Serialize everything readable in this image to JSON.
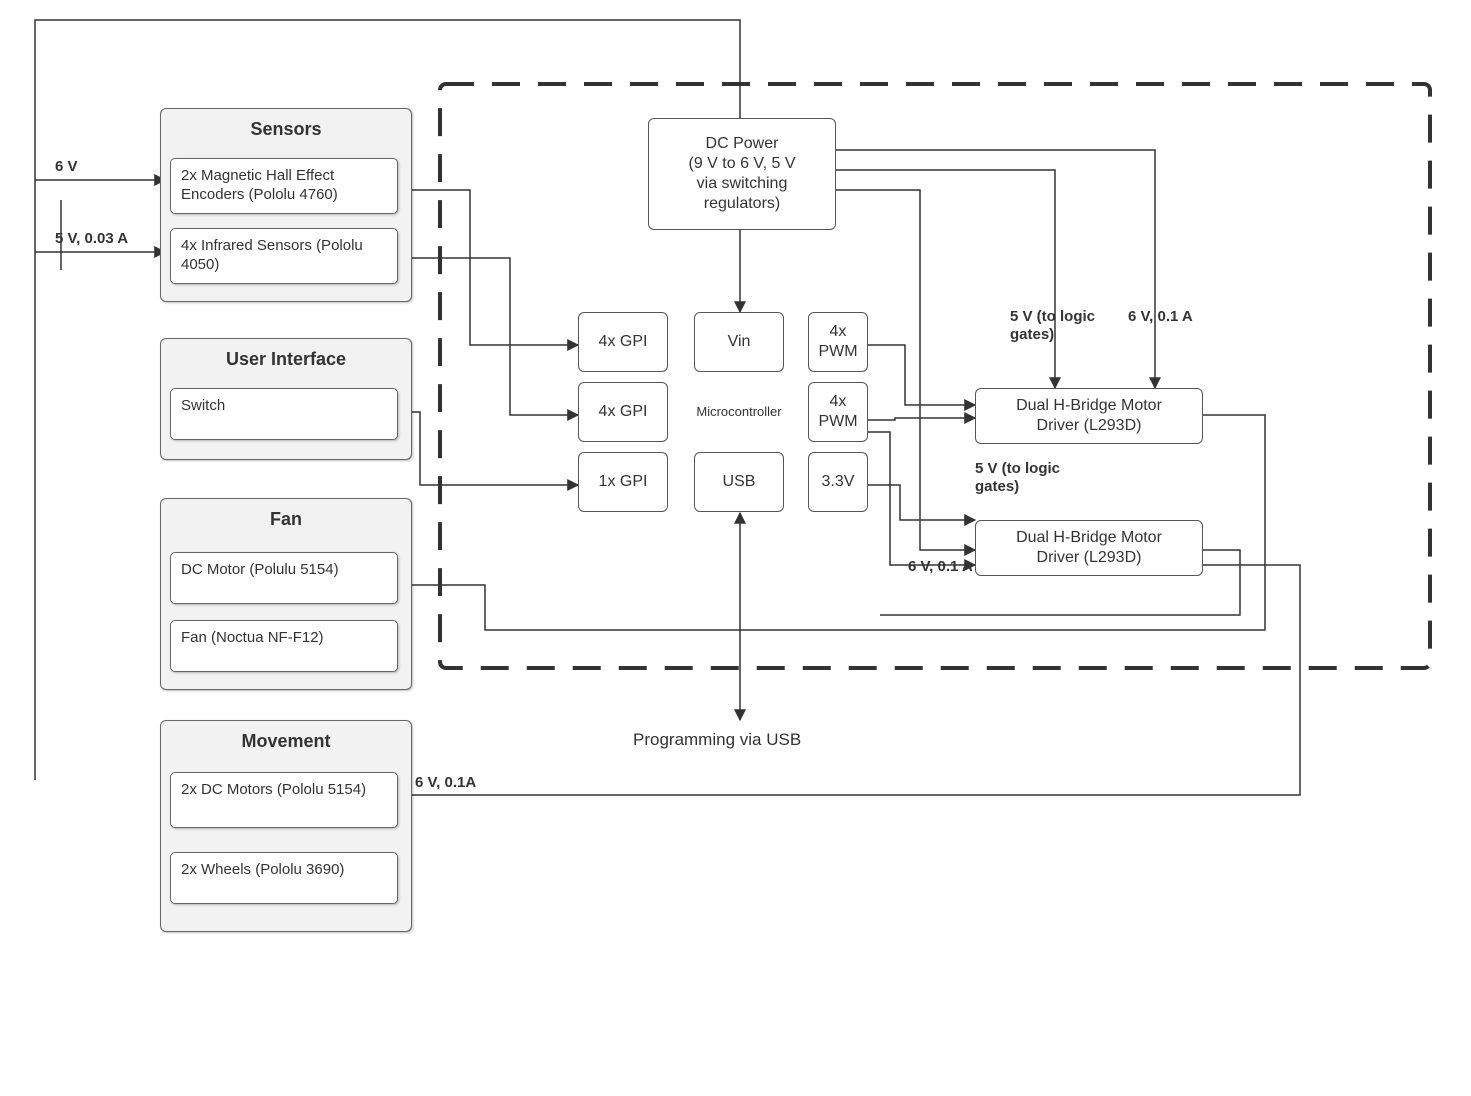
{
  "groups": {
    "sensors": {
      "title": "Sensors",
      "item1": "2x Magnetic Hall Effect Encoders (Pololu 4760)",
      "item2": "4x Infrared Sensors (Pololu 4050)"
    },
    "ui": {
      "title": "User Interface",
      "item1": "Switch"
    },
    "fan": {
      "title": "Fan",
      "item1": "DC Motor (Polulu 5154)",
      "item2": "Fan (Noctua NF-F12)"
    },
    "movement": {
      "title": "Movement",
      "item1": "2x DC Motors (Pololu 5154)",
      "item2": "2x Wheels (Pololu 3690)"
    }
  },
  "dc_power": "DC Power\n(9 V to 6 V, 5 V\nvia switching\nregulators)",
  "mc": {
    "center": "Microcontroller",
    "gpi4_a": "4x GPI",
    "gpi4_b": "4x GPI",
    "gpi1": "1x GPI",
    "vin": "Vin",
    "usb": "USB",
    "pwm_a": "4x\nPWM",
    "pwm_b": "4x\nPWM",
    "v33": "3.3V"
  },
  "driver1": "Dual H-Bridge Motor\nDriver (L293D)",
  "driver2": "Dual H-Bridge Motor\nDriver (L293D)",
  "usb_label": "Programming via USB",
  "edges": {
    "six_v": "6 V",
    "five_v_003a": "5 V, 0.03 A",
    "five_v_logic_1": "5 V (to logic\ngates)",
    "six_v_01a_1": "6 V, 0.1 A",
    "five_v_logic_2": "5 V (to logic\ngates)",
    "six_v_01a_2": "6 V, 0.1 A",
    "six_v_01a_bottom": "6 V, 0.1A"
  }
}
